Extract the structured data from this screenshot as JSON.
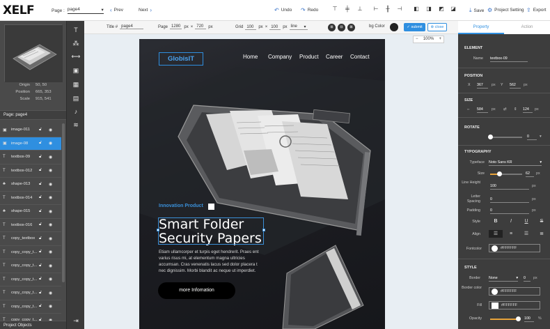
{
  "topbar": {
    "logo": "XELF",
    "page_label": "Page :",
    "page_value": "page4",
    "prev": "Prev",
    "next": "Next",
    "undo": "Undo",
    "redo": "Redo",
    "save": "Save",
    "project_setting": "Project Setting",
    "export": "Export"
  },
  "left": {
    "origin_label": "Origin",
    "origin": "50, 50",
    "position_label": "Position",
    "position": "665, 353",
    "scale_label": "Scale",
    "scale": "915, 541",
    "page_label": "Page: page4",
    "project_objects": "Project Objects",
    "layers": [
      {
        "icon": "image-icon",
        "name": "image-011",
        "selected": false
      },
      {
        "icon": "image-icon",
        "name": "image-08",
        "selected": true
      },
      {
        "icon": "text-icon",
        "name": "textbox-09",
        "selected": false
      },
      {
        "icon": "text-icon",
        "name": "textbox-012",
        "selected": false
      },
      {
        "icon": "shape-icon",
        "name": "shape-013",
        "selected": false
      },
      {
        "icon": "text-icon",
        "name": "textbox-014",
        "selected": false
      },
      {
        "icon": "shape-icon",
        "name": "shape-015",
        "selected": false
      },
      {
        "icon": "text-icon",
        "name": "textbox-016",
        "selected": false
      },
      {
        "icon": "text-icon",
        "name": "copy_textbox",
        "selected": false
      },
      {
        "icon": "text-icon",
        "name": "copy_copy_t...",
        "selected": false
      },
      {
        "icon": "text-icon",
        "name": "copy_copy_t...",
        "selected": false
      },
      {
        "icon": "text-icon",
        "name": "copy_copy_t...",
        "selected": false
      },
      {
        "icon": "text-icon",
        "name": "copy_copy_t...",
        "selected": false
      },
      {
        "icon": "text-icon",
        "name": "copy_copy_t...",
        "selected": false
      },
      {
        "icon": "text-icon",
        "name": "copy_copy_t...",
        "selected": false
      }
    ]
  },
  "canvasbar": {
    "title_label": "Title #",
    "title_value": "page4",
    "page_label": "Page",
    "page_w": "1280",
    "page_h": "720",
    "px": "px",
    "x": "×",
    "grid_label": "Grid",
    "grid_w": "100",
    "grid_h": "100",
    "grid_type": "line",
    "bg_color_label": "bg Color",
    "submit": "submit",
    "close": "close",
    "zoom": "100%"
  },
  "artboard": {
    "brand": "GlobisIT",
    "nav": [
      "Home",
      "Company",
      "Product",
      "Career",
      "Contact"
    ],
    "innovation": "Innovation Product",
    "headline_1": "Smart Folder",
    "headline_2": "Security Papers",
    "body": "Etiam ullamcorper et turpis eget hendrerit. Praes ent varius risus mi, at elementum magna ultricies accumsan. Cras venenatis lacus sed dolor placera t nec dignissim. Morbi blandit ac neque ut imperdiet.",
    "button": "more Infomation"
  },
  "right": {
    "tab_property": "Property",
    "tab_action": "Action",
    "element_sec": "ELEMENT",
    "name_label": "Name",
    "name_value": "textbox-09",
    "position_sec": "POSITION",
    "pos_x_label": "X",
    "pos_x": "367",
    "pos_y_label": "Y",
    "pos_y": "562",
    "size_sec": "SIZE",
    "size_w": "584",
    "size_h": "124",
    "rotate_sec": "ROTATE",
    "rotate_value": "0",
    "rotate_fraction": 0.0,
    "typography_sec": "TYPOGRAPHY",
    "typeface_label": "Typeface",
    "typeface": "Noto Sans KR",
    "size_label": "Size",
    "font_size": "62",
    "font_size_fraction": 0.3,
    "line_height_label": "Line Height",
    "line_height": "100",
    "letter_spacing_label": "Letter Spacing",
    "letter_spacing": "0",
    "padding_label": "Padding",
    "padding": "0",
    "style_label": "Style",
    "style_buttons": [
      "B",
      "I",
      "U",
      "S"
    ],
    "align_label": "Align",
    "align_selected": 0,
    "fontcolor_label": "Fontcolor",
    "fontcolor": "#FFFFFF",
    "style_sec": "STYLE",
    "border_label": "Border",
    "border_value": "None",
    "border_width": "0",
    "border_color_label": "Border color",
    "border_color": "#FFFFFF",
    "fill_label": "Fill",
    "fill": "#FFFFFF",
    "opacity_label": "Opacity",
    "opacity": "100",
    "opacity_fraction": 1.0,
    "unit_px": "px",
    "unit_pct": "%"
  },
  "colors": {
    "accent": "#2f8fe0",
    "artboard_bg": "#1c1d22",
    "panel_dark": "#3d3d3d",
    "slider_fill": "#e8a33a"
  }
}
